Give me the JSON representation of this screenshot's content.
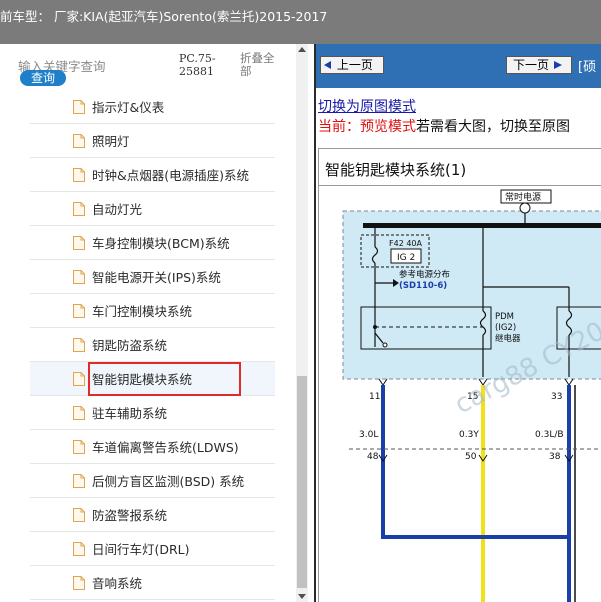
{
  "header": {
    "title": "前车型： 厂家:KIA(起亚汽车)Sorento(索兰托)2015-2017"
  },
  "sidebar": {
    "search_placeholder": "输入关键字查询",
    "search_button": "查询",
    "pc_code": "PC.75-25881",
    "collapse_label": "折叠全部",
    "items": [
      {
        "label": "指示灯&仪表"
      },
      {
        "label": "照明灯"
      },
      {
        "label": "时钟&点烟器(电源插座)系统"
      },
      {
        "label": "自动灯光"
      },
      {
        "label": "车身控制模块(BCM)系统"
      },
      {
        "label": "智能电源开关(IPS)系统"
      },
      {
        "label": "车门控制模块系统"
      },
      {
        "label": "钥匙防盗系统"
      },
      {
        "label": "智能钥匙模块系统",
        "selected": true
      },
      {
        "label": "驻车辅助系统"
      },
      {
        "label": "车道偏离警告系统(LDWS)"
      },
      {
        "label": "后侧方盲区监测(BSD) 系统"
      },
      {
        "label": "防盗警报系统"
      },
      {
        "label": "日间行车灯(DRL)"
      },
      {
        "label": "音响系统"
      }
    ]
  },
  "viewer": {
    "prev_button": "上一页",
    "next_button": "下一页",
    "toolbar_extra": "[硕",
    "switch_link": "切换为原图模式",
    "mode_prefix": "当前：",
    "mode_current": "预览模式",
    "mode_hint": "若需看大图，切换至原图",
    "diagram": {
      "title": "智能钥匙模块系统(1)",
      "power_label": "常时电源",
      "fuse_label": "F42 40A",
      "fuse_name": "IG 2",
      "ref_label": "参考电源分布",
      "ref_code": "(SD110-6)",
      "relay_label_1": "PDM",
      "relay_label_2": "(IG2)",
      "relay_label_3": "继电器",
      "pins_top": [
        "11",
        "15",
        "33"
      ],
      "wires": [
        "3.0L",
        "0.3Y",
        "0.3L/B"
      ],
      "pins_bottom": [
        "48",
        "50",
        "38"
      ],
      "watermark": "carg88 CY20"
    }
  },
  "colors": {
    "title_bar": "#7b7b7b",
    "search_button": "#1f7fc8",
    "toolbar": "#2f6fb4",
    "highlight": "#e02b2b",
    "diagram_fill": "#cfe9f5",
    "wire_blue": "#1a3fa8",
    "wire_yellow": "#f2e11a"
  }
}
